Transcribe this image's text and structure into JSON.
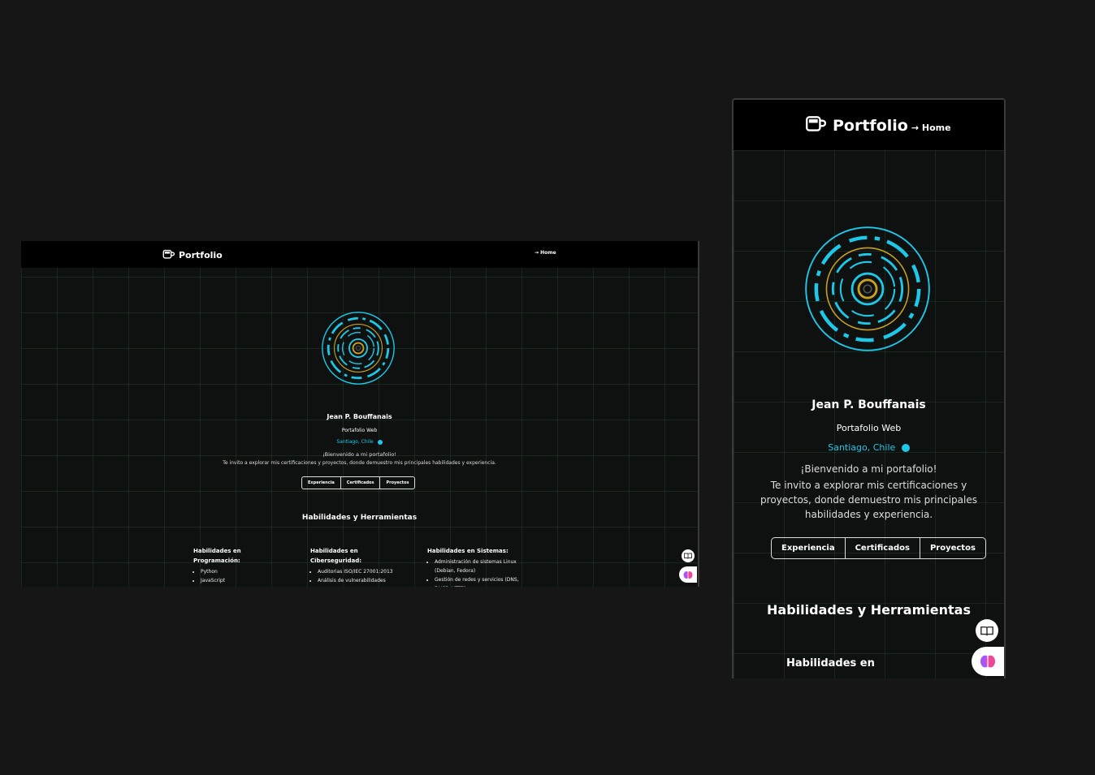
{
  "desktop": {
    "nav": {
      "brand": "Portfolio",
      "home": "→ Home"
    },
    "profile": {
      "name": "Jean P. Bouffanais",
      "role": "Portafolio Web",
      "location": "Santiago, Chile",
      "welcome": "¡Bienvenido a mi portafolio!",
      "intro": "Te invito a explorar mis certificaciones y proyectos, donde demuestro mis principales habilidades y experiencia."
    },
    "buttons": [
      "Experiencia",
      "Certificados",
      "Proyectos"
    ],
    "skills_title": "Habilidades y Herramientas",
    "columns": [
      {
        "title": "Habilidades en Programación:",
        "items": [
          "Python",
          "JavaScript"
        ]
      },
      {
        "title": "Habilidades en Ciberseguridad:",
        "items": [
          "Auditorias ISO/IEC 27001:2013",
          "Análisis de vulnerabilidades"
        ]
      },
      {
        "title": "Habilidades en Sistemas:",
        "items": [
          "Administración de sistemas Linux (Debian, Fedora)",
          "Gestión de redes y servicios (DNS, DHCP, HTTP)"
        ]
      }
    ]
  },
  "mobile": {
    "nav": {
      "brand": "Portfolio",
      "home": "→ Home"
    },
    "profile": {
      "name": "Jean P. Bouffanais",
      "role": "Portafolio Web",
      "location": "Santiago, Chile",
      "welcome": "¡Bienvenido a mi portafolio!",
      "intro": "Te invito a explorar mis certificaciones y proyectos, donde demuestro mis principales habilidades y experiencia."
    },
    "buttons": [
      "Experiencia",
      "Certificados",
      "Proyectos"
    ],
    "skills_title": "Habilidades y Herramientas",
    "subsection": "Habilidades en"
  },
  "colors": {
    "accent": "#1ec8e8",
    "ring_gold": "#c8a020",
    "background": "#161616"
  },
  "icons": {
    "logo": "coffee-cup-icon",
    "globe": "globe-icon",
    "book": "book-icon",
    "brain": "brain-icon"
  }
}
